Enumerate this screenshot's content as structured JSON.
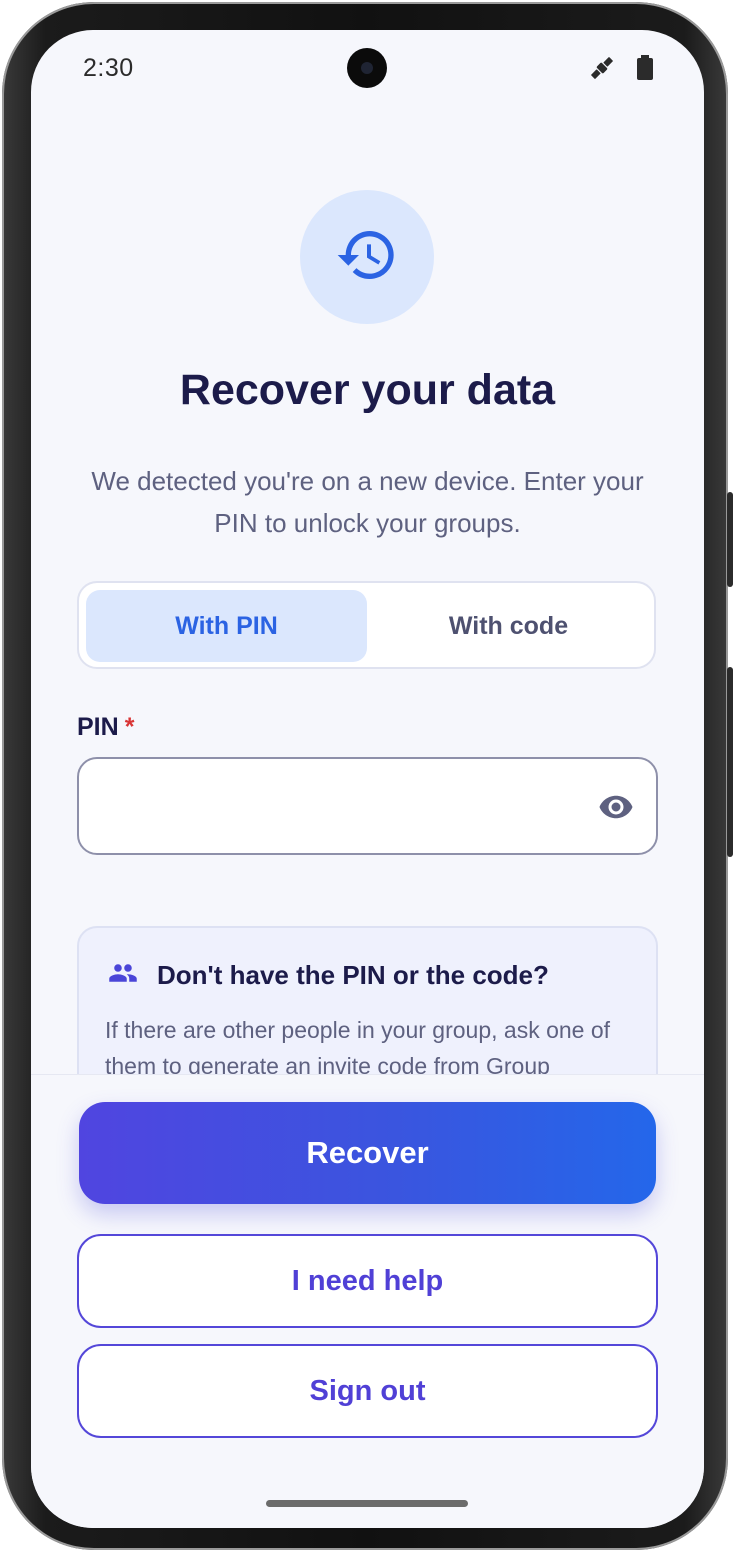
{
  "status_bar": {
    "time": "2:30",
    "icons": [
      "satellite-icon",
      "battery-icon"
    ]
  },
  "header": {
    "icon": "history-restore-icon",
    "title": "Recover your data",
    "subtitle": "We detected you're on a new device. Enter your PIN to unlock your groups."
  },
  "method_toggle": {
    "options": [
      {
        "label": "With PIN",
        "selected": true
      },
      {
        "label": "With code",
        "selected": false
      }
    ]
  },
  "pin_field": {
    "label": "PIN",
    "required_mark": "*",
    "value": "",
    "visibility_icon": "eye-icon"
  },
  "help_card": {
    "icon": "people-icon",
    "title": "Don't have the PIN or the code?",
    "body": "If there are other people in your group, ask one of them to generate an invite code from Group"
  },
  "actions": {
    "recover_label": "Recover",
    "help_label": "I need help",
    "signout_label": "Sign out"
  },
  "colors": {
    "primary_start": "#5045e0",
    "primary_end": "#2467ea",
    "accent": "#5447d9",
    "selected_tab_bg": "#dbe7fd",
    "selected_tab_text": "#2b63e3",
    "title_text": "#1c1b4a",
    "required": "#d93535"
  }
}
